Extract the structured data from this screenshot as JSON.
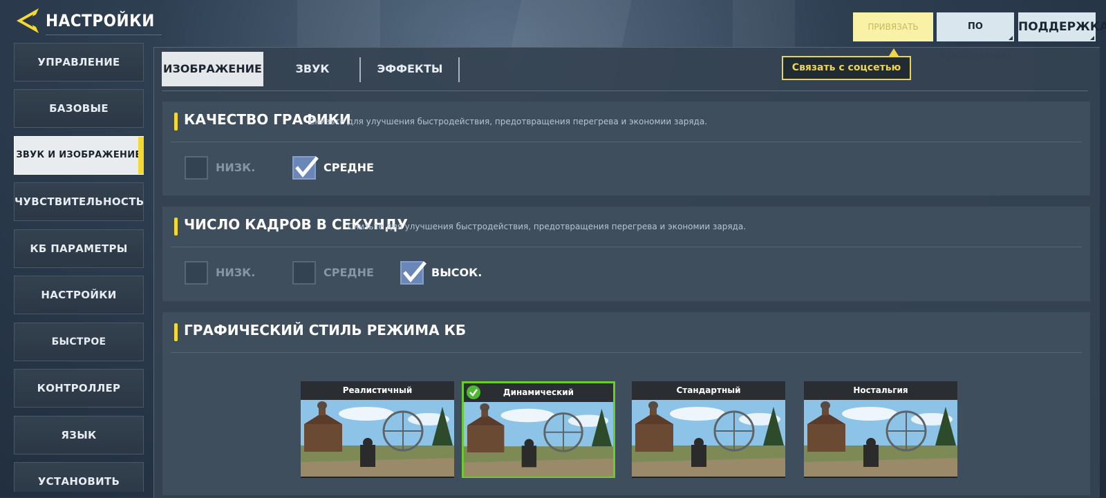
{
  "header": {
    "title": "НАСТРОЙКИ",
    "back_icon": "back-arrow-icon"
  },
  "top_buttons": {
    "bind": "ПРИВЯЗАТЬ",
    "default": "ПО УМОЛЧАНИЮ",
    "support": "ПОДДЕРЖКА"
  },
  "tooltip": {
    "text": "Связать с соцсетью"
  },
  "sidebar": {
    "items": [
      {
        "label": "УПРАВЛЕНИЕ"
      },
      {
        "label": "БАЗОВЫЕ"
      },
      {
        "label": "ЗВУК И ИЗОБРАЖЕНИЕ",
        "active": true
      },
      {
        "label": "ЧУВСТВИТЕЛЬНОСТЬ"
      },
      {
        "label": "КБ ПАРАМЕТРЫ"
      },
      {
        "label": "НАСТРОЙКИ ТЕХНИКИ"
      },
      {
        "label": "БЫСТРОЕ СООБЩЕНИЕ"
      },
      {
        "label": "КОНТРОЛЛЕР"
      },
      {
        "label": "ЯЗЫК"
      },
      {
        "label": "УСТАНОВИТЬ"
      }
    ]
  },
  "tabs": [
    {
      "label": "ИЗОБРАЖЕНИЕ",
      "active": true
    },
    {
      "label": "ЗВУК"
    },
    {
      "label": "ЭФФЕКТЫ"
    }
  ],
  "graphics_quality": {
    "title": "КАЧЕСТВО ГРАФИКИ",
    "hint": "Снизьте для улучшения быстродействия, предотвращения перегрева и экономии заряда.",
    "options": [
      {
        "label": "НИЗК.",
        "checked": false
      },
      {
        "label": "СРЕДНЕ",
        "checked": true
      }
    ]
  },
  "frame_rate": {
    "title": "ЧИСЛО КАДРОВ В СЕКУНДУ",
    "hint": "Снизьте для улучшения быстродействия, предотвращения перегрева и экономии заряда.",
    "options": [
      {
        "label": "НИЗК.",
        "checked": false
      },
      {
        "label": "СРЕДНЕ",
        "checked": false
      },
      {
        "label": "ВЫСОК.",
        "checked": true
      }
    ]
  },
  "br_style": {
    "title": "ГРАФИЧЕСКИЙ СТИЛЬ РЕЖИМА КБ",
    "styles": [
      {
        "label": "Реалистичный",
        "selected": false
      },
      {
        "label": "Динамический",
        "selected": true
      },
      {
        "label": "Стандартный",
        "selected": false
      },
      {
        "label": "Ностальгия",
        "selected": false
      }
    ]
  },
  "colors": {
    "accent": "#f4d932",
    "selected_border": "#6ccc2f",
    "checkbox_checked": "#6a87b8"
  }
}
